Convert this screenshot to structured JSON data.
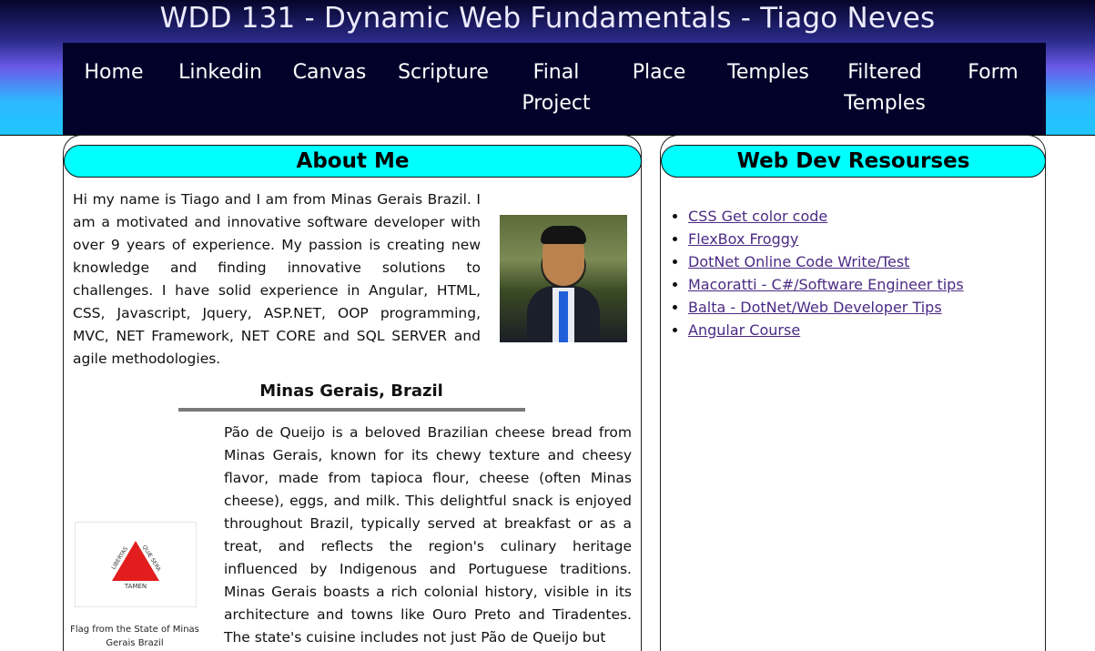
{
  "site": {
    "title": "WDD 131 - Dynamic Web Fundamentals - Tiago Neves"
  },
  "nav": {
    "items": [
      {
        "label": "Home"
      },
      {
        "label": "Linkedin"
      },
      {
        "label": "Canvas"
      },
      {
        "label": "Scripture"
      },
      {
        "label": "Final Project"
      },
      {
        "label": "Place"
      },
      {
        "label": "Temples"
      },
      {
        "label": "Filtered Temples"
      },
      {
        "label": "Form"
      }
    ]
  },
  "about": {
    "heading": "About Me",
    "bio": "Hi my name is Tiago and I am from Minas Gerais Brazil. I am a motivated and innovative software developer with over 9 years of experience. My passion is creating new knowledge and finding innovative solutions to challenges. I have solid experience in Angular, HTML, CSS, Javascript, Jquery, ASP.NET, OOP programming, MVC, NET Framework, NET CORE and SQL SERVER and agile methodologies.",
    "state_heading": "Minas Gerais, Brazil",
    "flag_text": "LIBERTAS QUÆ SERA TAMEN",
    "flag_caption": "Flag from the State of Minas Gerais Brazil",
    "state_text": "Pão de Queijo is a beloved Brazilian cheese bread from Minas Gerais, known for its chewy texture and cheesy flavor, made from tapioca flour, cheese (often Minas cheese), eggs, and milk. This delightful snack is enjoyed throughout Brazil, typically served at breakfast or as a treat, and reflects the region's culinary heritage influenced by Indigenous and Portuguese traditions. Minas Gerais boasts a rich colonial history, visible in its architecture and towns like Ouro Preto and Tiradentes. The state's cuisine includes not just Pão de Queijo but"
  },
  "resources": {
    "heading": "Web Dev Resourses",
    "links": [
      {
        "label": "CSS Get color code"
      },
      {
        "label": "FlexBox Froggy"
      },
      {
        "label": "DotNet Online Code Write/Test"
      },
      {
        "label": "Macoratti - C#/Software Engineer tips"
      },
      {
        "label": "Balta - DotNet/Web Developer Tips"
      },
      {
        "label": "Angular Course"
      }
    ]
  },
  "colors": {
    "panel_heading_bg": "#00ffff",
    "nav_bg": "#02012a",
    "link": "#4b2a84"
  }
}
